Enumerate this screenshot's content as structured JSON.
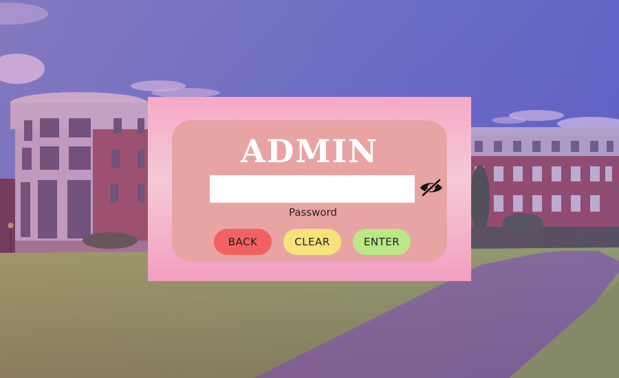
{
  "login": {
    "title": "ADMIN",
    "password_label": "Password",
    "password_value": "",
    "password_placeholder": "",
    "toggle_icon": "eye-slash-icon",
    "buttons": {
      "back": "BACK",
      "clear": "CLEAR",
      "enter": "ENTER"
    }
  },
  "colors": {
    "card": "#f6b8cd",
    "panel": "#e8a4a3",
    "back_button": "#f26161",
    "clear_button": "#f9e27c",
    "enter_button": "#b9e886"
  }
}
